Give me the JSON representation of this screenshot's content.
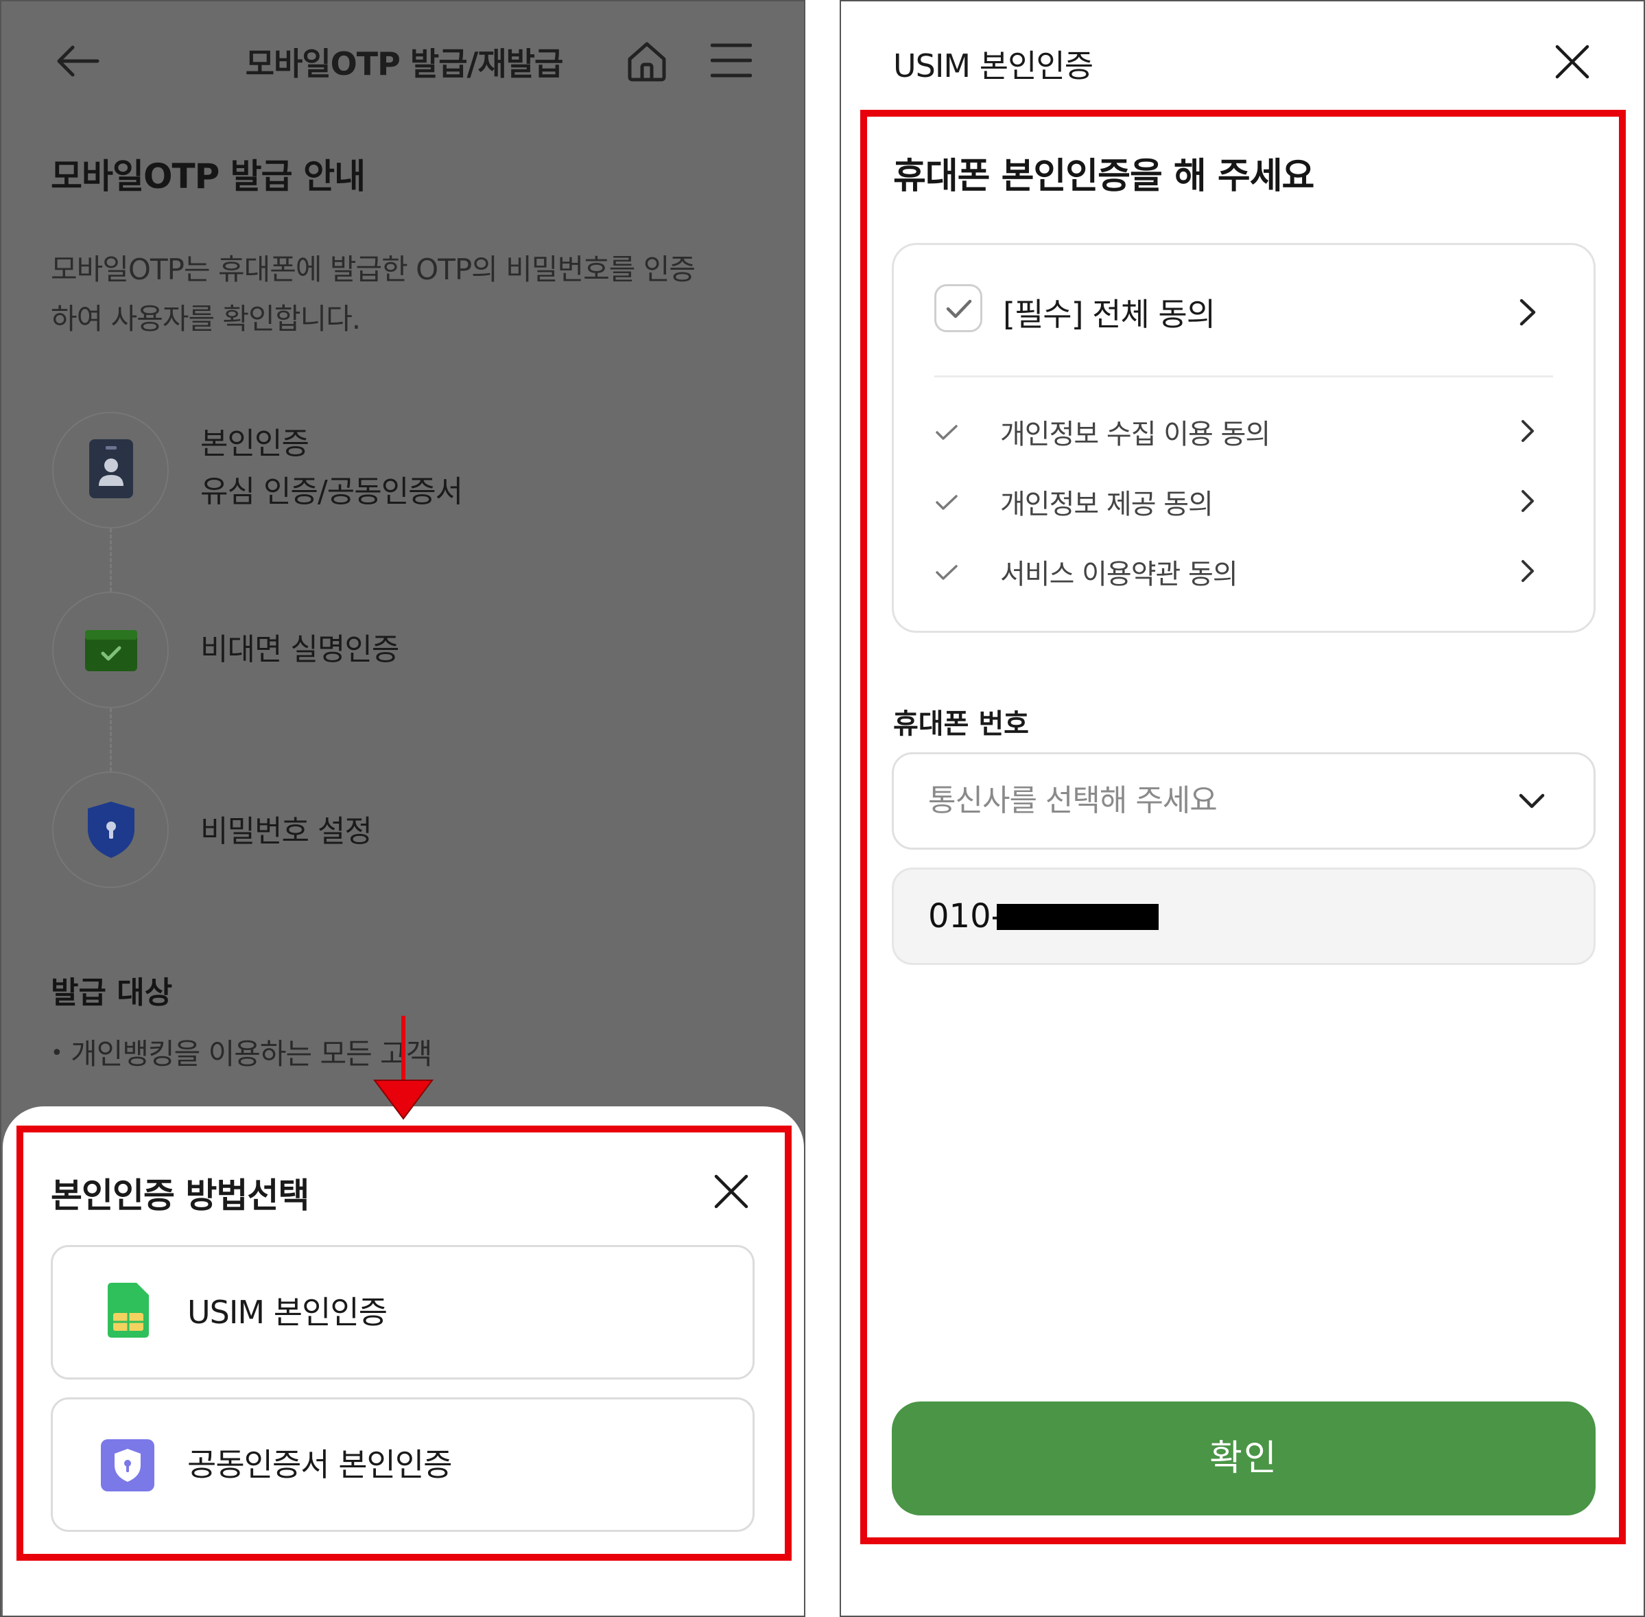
{
  "left": {
    "header": {
      "title": "모바일OTP 발급/재발급"
    },
    "intro": {
      "title": "모바일OTP 발급 안내",
      "line1": "모바일OTP는 휴대폰에 발급한 OTP의 비밀번호를 인증",
      "line2": "하여 사용자를 확인합니다."
    },
    "steps": [
      {
        "line1": "본인인증",
        "line2": "유심 인증/공동인증서",
        "icon": "id-badge-icon"
      },
      {
        "line1": "비대면 실명인증",
        "icon": "verified-card-icon"
      },
      {
        "line1": "비밀번호 설정",
        "icon": "shield-lock-icon"
      }
    ],
    "target": {
      "title": "발급 대상",
      "bullet": "개인뱅킹을 이용하는 모든 고객"
    },
    "sheet": {
      "title": "본인인증 방법선택",
      "options": [
        {
          "label": "USIM 본인인증",
          "icon": "usim-card-icon"
        },
        {
          "label": "공동인증서 본인인증",
          "icon": "certificate-shield-icon"
        }
      ]
    }
  },
  "right": {
    "title": "USIM 본인인증",
    "heading": "휴대폰 본인인증을 해 주세요",
    "agree_all": "[필수] 전체 동의",
    "agree_items": [
      "개인정보 수집 이용 동의",
      "개인정보 제공 동의",
      "서비스 이용약관 동의"
    ],
    "phone": {
      "label": "휴대폰 번호",
      "carrier_placeholder": "통신사를 선택해 주세요",
      "prefix": "010-"
    },
    "confirm": "확인"
  },
  "colors": {
    "highlight_red": "#e8000b",
    "confirm_green": "#4a9546",
    "overlay_gray": "#6b6b6b",
    "usim_green": "#2fbf5b",
    "certificate_purple": "#7b78e8"
  }
}
